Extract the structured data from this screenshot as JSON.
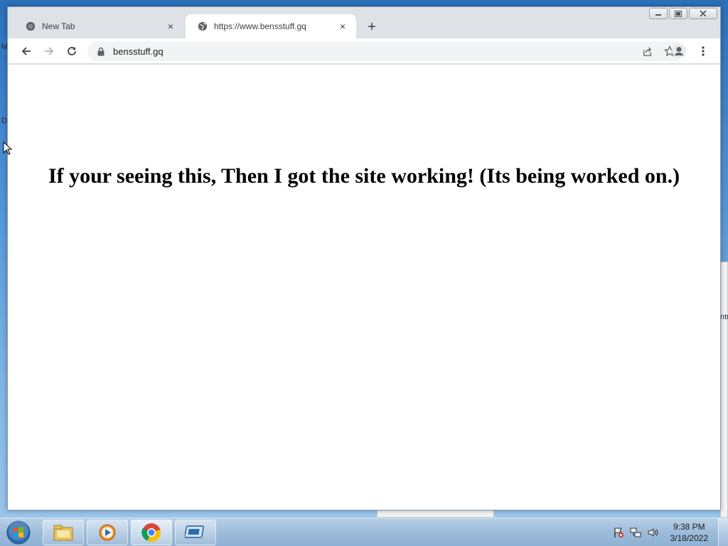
{
  "browser": {
    "tabs": [
      {
        "title": "New Tab",
        "active": false
      },
      {
        "title": "https://www.bensstuff.gq",
        "active": true
      }
    ],
    "new_tab_symbol": "+",
    "close_symbol": "×",
    "address": "bensstuff.gq",
    "icons": {
      "back": "back-arrow-icon",
      "forward": "forward-arrow-icon",
      "reload": "reload-icon",
      "lock": "lock-icon",
      "share": "share-icon",
      "bookmark": "star-icon",
      "profile": "profile-icon",
      "menu": "kebab-menu-icon"
    }
  },
  "page": {
    "heading": "If your seeing this, Then I got the site working! (Its being worked on.)"
  },
  "desktop": {
    "fragments": [
      "M",
      "D",
      "ntr"
    ]
  },
  "taskbar": {
    "clock_time": "9:38 PM",
    "clock_date": "3/18/2022",
    "apps": [
      "windows-explorer-icon",
      "media-player-icon",
      "chrome-icon",
      "remote-desktop-icon"
    ]
  },
  "colors": {
    "tabstrip": "#dee1e6",
    "omnibox": "#f1f3f4",
    "taskbar": "#9dbcdb"
  }
}
